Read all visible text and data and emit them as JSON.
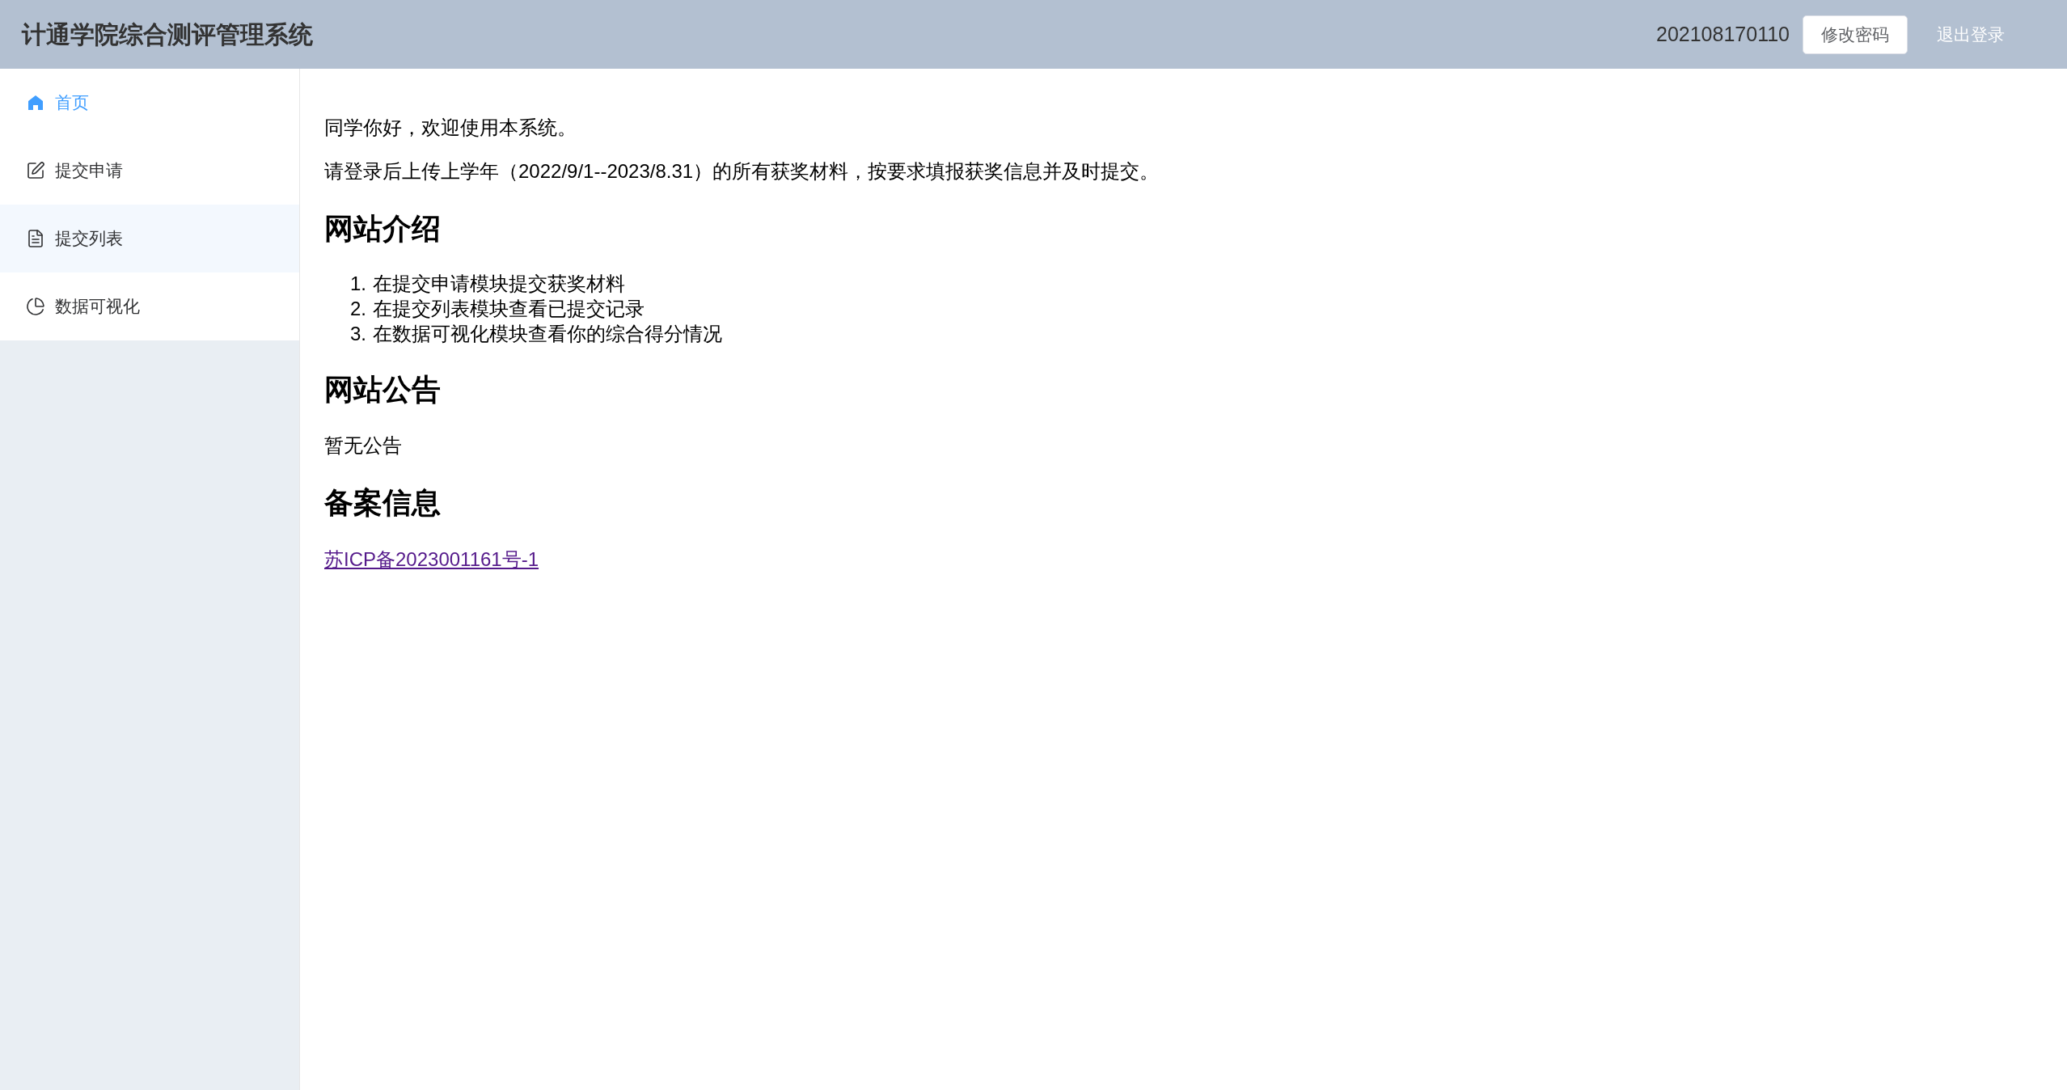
{
  "header": {
    "title": "计通学院综合测评管理系统",
    "user_id": "202108170110",
    "buttons": [
      {
        "kind": "filled",
        "label": "修改密码"
      },
      {
        "kind": "text",
        "label": "退出登录"
      }
    ]
  },
  "sidebar": {
    "items": [
      {
        "label": "首页",
        "selected": true,
        "hovered": false
      },
      {
        "label": "提交申请",
        "selected": false,
        "hovered": false
      },
      {
        "label": "提交列表",
        "selected": false,
        "hovered": true
      },
      {
        "label": "数据可视化",
        "selected": false,
        "hovered": false
      }
    ]
  },
  "content": {
    "greeting": "同学你好，欢迎使用本系统。",
    "instruction": "请登录后上传上学年（2022/9/1--2023/8.31）的所有获奖材料，按要求填报获奖信息并及时提交。",
    "sections": [
      {
        "heading": "网站介绍",
        "kind": "list",
        "items": [
          {
            "number": "1.",
            "text": "在提交申请模块提交获奖材料"
          },
          {
            "number": "2.",
            "text": "在提交列表模块查看已提交记录"
          },
          {
            "number": "3.",
            "text": "在数据可视化模块查看你的综合得分情况"
          }
        ]
      },
      {
        "heading": "网站公告",
        "kind": "text",
        "text": "暂无公告"
      },
      {
        "heading": "备案信息",
        "kind": "link",
        "text": "苏ICP备2023001161号-1"
      }
    ]
  }
}
